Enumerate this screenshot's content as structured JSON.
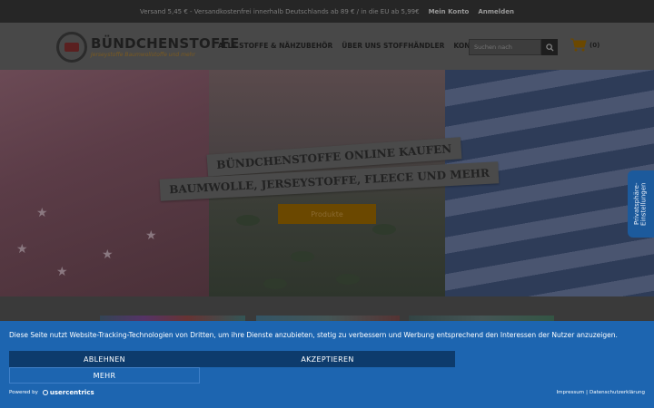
{
  "topbar": {
    "shipping_text": "Versand 5,45 € - Versandkostenfrei innerhalb Deutschlands ab 89 € / in die EU ab 5,99€",
    "account_label": "Mein Konto",
    "login_label": "Anmelden"
  },
  "header": {
    "logo_name": "BÜNDCHENSTOFFE",
    "logo_tagline": "Jerseystoffe Baumwollstoffe und mehr",
    "nav": [
      {
        "label": "ALLE STOFFE & NÄHZUBEHÖR"
      },
      {
        "label": "ÜBER UNS STOFFHÄNDLER"
      },
      {
        "label": "KONTAKT"
      }
    ],
    "search_placeholder": "Suchen nach",
    "cart_count": "(0)"
  },
  "hero": {
    "headline_1": "BÜNDCHENSTOFFE ONLINE KAUFEN",
    "headline_2": "BAUMWOLLE, JERSEYSTOFFE, FLEECE UND MEHR",
    "cta_label": "Produkte"
  },
  "privacy_tab": {
    "label": "Privatsphäre-Einstellungen"
  },
  "consent": {
    "message": "Diese Seite nutzt Website-Tracking-Technologien von Dritten, um ihre Dienste anzubieten, stetig zu verbessern und Werbung entsprechend den Interessen der Nutzer anzuzeigen.",
    "decline_label": "ABLEHNEN",
    "accept_label": "AKZEPTIEREN",
    "more_label": "MEHR",
    "powered_by": "Powered by",
    "brand": "usercentrics",
    "impressum": "Impressum",
    "separator": "|",
    "privacy_link": "Datenschutzerklärung"
  },
  "colors": {
    "consent_bg": "#1d65b0",
    "consent_button": "#0d3b6c",
    "privacy_tab": "#1c5a9c",
    "cta": "#6b4800"
  }
}
